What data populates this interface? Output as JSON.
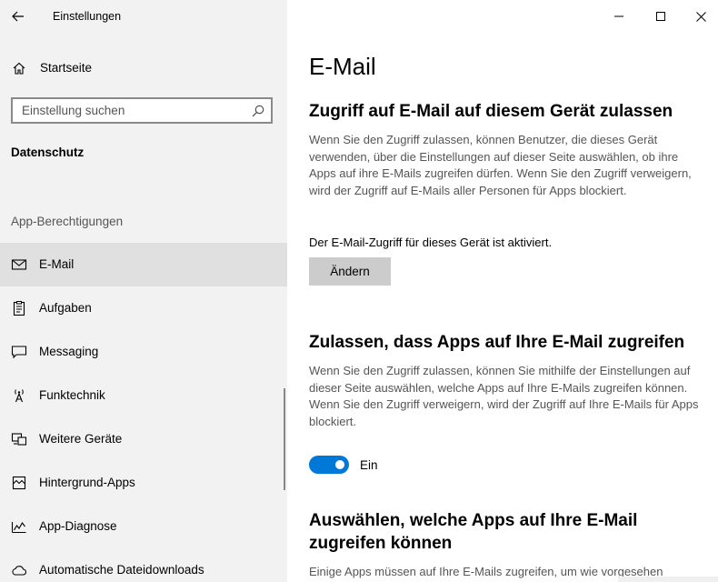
{
  "window": {
    "title": "Einstellungen"
  },
  "sidebar": {
    "home_label": "Startseite",
    "search_placeholder": "Einstellung suchen",
    "section_title": "Datenschutz",
    "group_label": "App-Berechtigungen",
    "items": [
      {
        "label": "E-Mail",
        "icon": "mail-icon",
        "selected": true
      },
      {
        "label": "Aufgaben",
        "icon": "clipboard-icon",
        "selected": false
      },
      {
        "label": "Messaging",
        "icon": "chat-icon",
        "selected": false
      },
      {
        "label": "Funktechnik",
        "icon": "antenna-icon",
        "selected": false
      },
      {
        "label": "Weitere Geräte",
        "icon": "devices-icon",
        "selected": false
      },
      {
        "label": "Hintergrund-Apps",
        "icon": "background-apps-icon",
        "selected": false
      },
      {
        "label": "App-Diagnose",
        "icon": "diagnostics-icon",
        "selected": false
      },
      {
        "label": "Automatische Dateidownloads",
        "icon": "cloud-icon",
        "selected": false
      }
    ]
  },
  "main": {
    "page_title": "E-Mail",
    "section1": {
      "heading": "Zugriff auf E-Mail auf diesem Gerät zulassen",
      "description": "Wenn Sie den Zugriff zulassen, können Benutzer, die dieses Gerät verwenden, über die Einstellungen auf dieser Seite auswählen, ob ihre Apps auf ihre E-Mails zugreifen dürfen. Wenn Sie den Zugriff verweigern, wird der Zugriff auf E-Mails aller Personen für Apps blockiert.",
      "status": "Der E-Mail-Zugriff für dieses Gerät ist aktiviert.",
      "button_label": "Ändern"
    },
    "section2": {
      "heading": "Zulassen, dass Apps auf Ihre E-Mail zugreifen",
      "description": "Wenn Sie den Zugriff zulassen, können Sie mithilfe der Einstellungen auf dieser Seite auswählen, welche Apps auf Ihre E-Mails zugreifen können. Wenn Sie den Zugriff verweigern, wird der Zugriff auf Ihre E-Mails für Apps blockiert.",
      "toggle_on": true,
      "toggle_label": "Ein"
    },
    "section3": {
      "heading": "Auswählen, welche Apps auf Ihre E-Mail zugreifen können",
      "description": "Einige Apps müssen auf Ihre E-Mails zugreifen, um wie vorgesehen"
    }
  },
  "colors": {
    "accent": "#0078d7",
    "sidebar_bg": "#f2f2f2",
    "selected_bg": "#e0e0e0",
    "secondary_text": "#555555"
  }
}
